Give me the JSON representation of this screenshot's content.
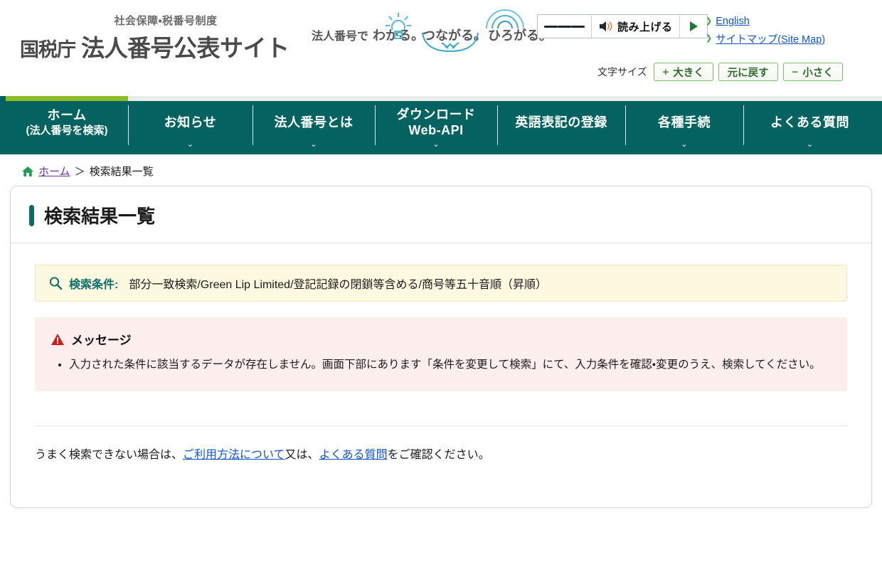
{
  "header": {
    "brand": {
      "tagline": "社会保障・税番号制度",
      "agency": "国税庁",
      "sitename": "法人番号公表サイト"
    },
    "slogan": {
      "label": "法人番号で",
      "part1": "わかる。",
      "part2": "つながる。",
      "part3": "ひろがる。",
      "icon1": "lightbulb-icon",
      "icon2": "handshake-icon",
      "icon3": "signal-waves-icon"
    },
    "speak": {
      "menu_icon": "hamburger-icon",
      "speaker_icon": "speaker-icon",
      "label": "読み上げる",
      "play_icon": "play-icon"
    },
    "toplinks": [
      {
        "label": "English",
        "bullet": "arrow-bullet-icon"
      },
      {
        "label": "サイトマップ(Site Map)",
        "bullet": "arrow-bullet-icon"
      }
    ],
    "fontsize": {
      "label": "文字サイズ",
      "larger": {
        "sign": "+",
        "label": "大きく"
      },
      "reset": {
        "sign": "",
        "label": "元に戻す"
      },
      "smaller": {
        "sign": "−",
        "label": "小さく"
      }
    }
  },
  "nav": {
    "items": [
      {
        "main": "ホーム",
        "sub": "(法人番号を検索)",
        "chevron": "",
        "active": true
      },
      {
        "main": "お知らせ",
        "sub": "",
        "chevron": "⌄",
        "active": false
      },
      {
        "main": "法人番号とは",
        "sub": "",
        "chevron": "⌄",
        "active": false
      },
      {
        "main": "ダウンロード",
        "sub": "Web-API",
        "chevron": "⌄",
        "active": false
      },
      {
        "main": "英語表記の登録",
        "sub": "",
        "chevron": "",
        "active": false
      },
      {
        "main": "各種手続",
        "sub": "",
        "chevron": "⌄",
        "active": false
      },
      {
        "main": "よくある質問",
        "sub": "",
        "chevron": "⌄",
        "active": false
      }
    ]
  },
  "breadcrumb": {
    "home_icon": "home-icon",
    "home_label": "ホーム",
    "separator": "＞",
    "current": "検索結果一覧"
  },
  "main": {
    "page_title": "検索結果一覧",
    "condition": {
      "icon": "search-icon",
      "label": "検索条件:",
      "value": "部分一致検索/Green Lip Limited/登記記録の閉鎖等含める/商号等五十音順（昇順）"
    },
    "message": {
      "icon": "warning-icon",
      "title": "メッセージ",
      "items": [
        "入力された条件に該当するデータが存在しません。画面下部にあります「条件を変更して検索」にて、入力条件を確認・変更のうえ、検索してください。"
      ]
    },
    "help": {
      "prefix": "うまく検索できない場合は、",
      "link1": "ご利用方法について",
      "middle": "又は、",
      "link2": "よくある質問",
      "suffix": "をご確認ください。"
    }
  },
  "colors": {
    "nav_teal": "#046260",
    "accent_green": "#8cbf26",
    "title_bar": "#0c6b66",
    "condition_bg": "#fcf9e0",
    "message_bg": "#fdeeee",
    "warning_red": "#d61a1a",
    "link_blue": "#1155cc",
    "visited_purple": "#6b2fa0"
  }
}
